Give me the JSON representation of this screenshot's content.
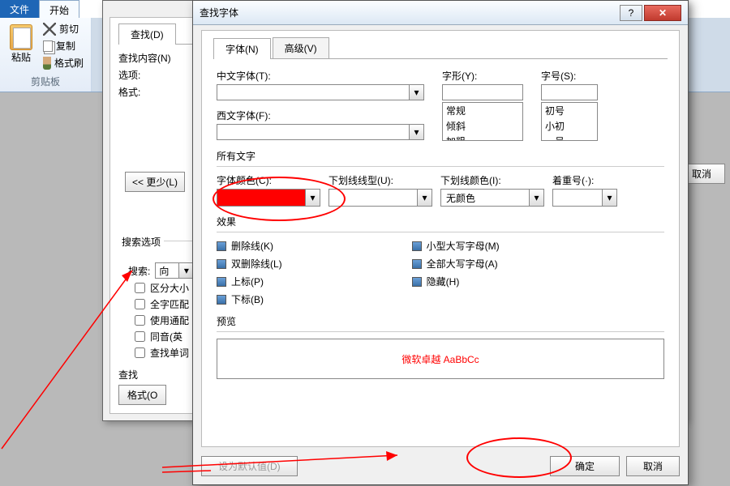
{
  "ribbon": {
    "file": "文件",
    "start": "开始",
    "paste": "粘贴",
    "cut": "剪切",
    "copy": "复制",
    "brush": "格式刷",
    "clipboard_group": "剪贴板"
  },
  "find": {
    "tab_find": "查找(D)",
    "content_label": "查找内容(N)",
    "options_label": "选项:",
    "format_label": "格式:",
    "less_btn": "<< 更少(L)",
    "search_opts_title": "搜索选项",
    "search_label": "搜索:",
    "search_dir": "向",
    "chk_case": "区分大小",
    "chk_whole": "全字匹配",
    "chk_wildcard": "使用通配",
    "chk_homo": "同音(英",
    "chk_single": "查找单词",
    "bottom_find": "查找",
    "format_btn": "格式(O"
  },
  "cancel_float": "取消",
  "font": {
    "title": "查找字体",
    "tab_font": "字体(N)",
    "tab_adv": "高级(V)",
    "cn_font_label": "中文字体(T):",
    "en_font_label": "西文字体(F):",
    "style_label": "字形(Y):",
    "size_label": "字号(S):",
    "style_opts": [
      "常规",
      "倾斜",
      "加粗"
    ],
    "size_opts": [
      "初号",
      "小初",
      "一号"
    ],
    "all_text": "所有文字",
    "font_color_label": "字体颜色(C):",
    "underline_style_label": "下划线线型(U):",
    "underline_color_label": "下划线颜色(I):",
    "underline_color_val": "无颜色",
    "emphasis_label": "着重号(·):",
    "effects_title": "效果",
    "eff_strike": "删除线(K)",
    "eff_dblstrike": "双删除线(L)",
    "eff_super": "上标(P)",
    "eff_sub": "下标(B)",
    "eff_smallcaps": "小型大写字母(M)",
    "eff_allcaps": "全部大写字母(A)",
    "eff_hidden": "隐藏(H)",
    "preview_title": "预览",
    "preview_text": "微软卓越  AaBbCc",
    "set_default": "设为默认值(D)",
    "ok": "确定",
    "cancel": "取消"
  }
}
